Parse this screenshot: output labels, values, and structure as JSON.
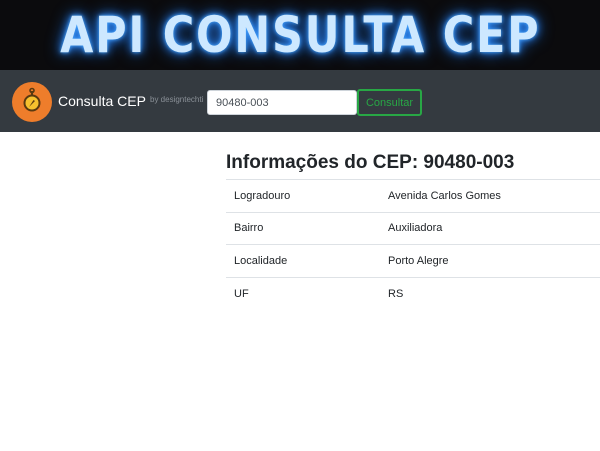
{
  "banner": {
    "title": "API CONSULTA CEP"
  },
  "navbar": {
    "brand": "Consulta CEP",
    "byline": "by designtechti",
    "search": {
      "value": "90480-003",
      "button_label": "Consultar"
    }
  },
  "main": {
    "title": "Informações do CEP: 90480-003",
    "rows": [
      {
        "field": "Logradouro",
        "value": "Avenida Carlos Gomes"
      },
      {
        "field": "Bairro",
        "value": "Auxiliadora"
      },
      {
        "field": "Localidade",
        "value": "Porto Alegre"
      },
      {
        "field": "UF",
        "value": "RS"
      }
    ]
  },
  "colors": {
    "navbar_bg": "#343a40",
    "logo_bg": "#ee7d2b",
    "success": "#28a745",
    "banner_glow": "#2f8cff"
  },
  "icons": {
    "logo": "compass-pin-icon"
  }
}
